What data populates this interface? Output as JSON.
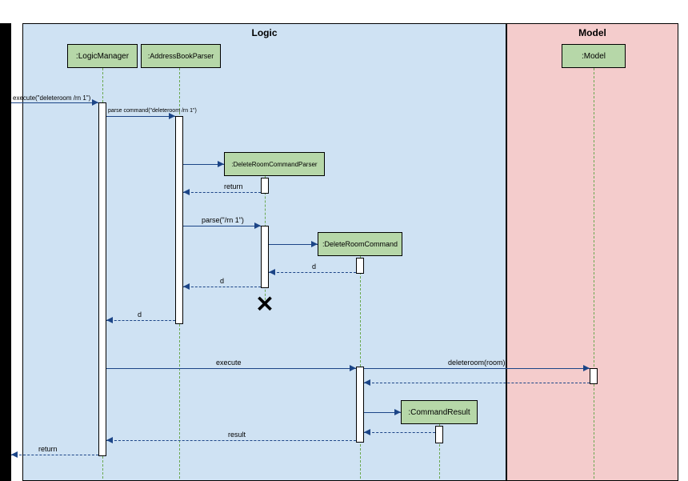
{
  "regions": {
    "logic": {
      "title": "Logic"
    },
    "model": {
      "title": "Model"
    }
  },
  "participants": {
    "logicManager": ":LogicManager",
    "addressBookParser": ":AddressBookParser",
    "deleteRoomCommandParser": ":DeleteRoomCommandParser",
    "deleteRoomCommand": ":DeleteRoomCommand",
    "commandResult": ":CommandResult",
    "model": ":Model"
  },
  "messages": {
    "executeEntry": "execute(\"deleteroom /rn 1\")",
    "parseCommand": "parse command(\"deleteroom /rn 1\")",
    "returnParser": "return",
    "parseArg": "parse(\"/rn 1\")",
    "d1": "d",
    "d2": "d",
    "d3": "d",
    "execute": "execute",
    "deleteroom": "deleteroom(room)",
    "result": "result",
    "returnFinal": "return"
  },
  "chart_data": {
    "type": "sequence-diagram",
    "regions": [
      {
        "name": "Logic",
        "participants": [
          "LogicManager",
          "AddressBookParser",
          "DeleteRoomCommandParser",
          "DeleteRoomCommand",
          "CommandResult"
        ]
      },
      {
        "name": "Model",
        "participants": [
          "Model"
        ]
      }
    ],
    "participants": [
      ":LogicManager",
      ":AddressBookParser",
      ":DeleteRoomCommandParser",
      ":DeleteRoomCommand",
      ":CommandResult",
      ":Model"
    ],
    "messages": [
      {
        "from": "caller",
        "to": "LogicManager",
        "label": "execute(\"deleteroom /rn 1\")",
        "type": "sync"
      },
      {
        "from": "LogicManager",
        "to": "AddressBookParser",
        "label": "parse command(\"deleteroom /rn 1\")",
        "type": "sync"
      },
      {
        "from": "AddressBookParser",
        "to": "DeleteRoomCommandParser",
        "label": "<create>",
        "type": "sync"
      },
      {
        "from": "DeleteRoomCommandParser",
        "to": "AddressBookParser",
        "label": "return",
        "type": "return"
      },
      {
        "from": "AddressBookParser",
        "to": "DeleteRoomCommandParser",
        "label": "parse(\"/rn 1\")",
        "type": "sync"
      },
      {
        "from": "DeleteRoomCommandParser",
        "to": "DeleteRoomCommand",
        "label": "<create>",
        "type": "sync"
      },
      {
        "from": "DeleteRoomCommand",
        "to": "DeleteRoomCommandParser",
        "label": "d",
        "type": "return"
      },
      {
        "from": "DeleteRoomCommandParser",
        "to": "AddressBookParser",
        "label": "d",
        "type": "return"
      },
      {
        "from": "DeleteRoomCommandParser",
        "to": "DeleteRoomCommandParser",
        "label": "<destroy>",
        "type": "destroy"
      },
      {
        "from": "AddressBookParser",
        "to": "LogicManager",
        "label": "d",
        "type": "return"
      },
      {
        "from": "LogicManager",
        "to": "DeleteRoomCommand",
        "label": "execute",
        "type": "sync"
      },
      {
        "from": "DeleteRoomCommand",
        "to": "Model",
        "label": "deleteroom(room)",
        "type": "sync"
      },
      {
        "from": "Model",
        "to": "DeleteRoomCommand",
        "label": "",
        "type": "return"
      },
      {
        "from": "DeleteRoomCommand",
        "to": "CommandResult",
        "label": "<create>",
        "type": "sync"
      },
      {
        "from": "CommandResult",
        "to": "DeleteRoomCommand",
        "label": "",
        "type": "return"
      },
      {
        "from": "DeleteRoomCommand",
        "to": "LogicManager",
        "label": "result",
        "type": "return"
      },
      {
        "from": "LogicManager",
        "to": "caller",
        "label": "return",
        "type": "return"
      }
    ]
  }
}
